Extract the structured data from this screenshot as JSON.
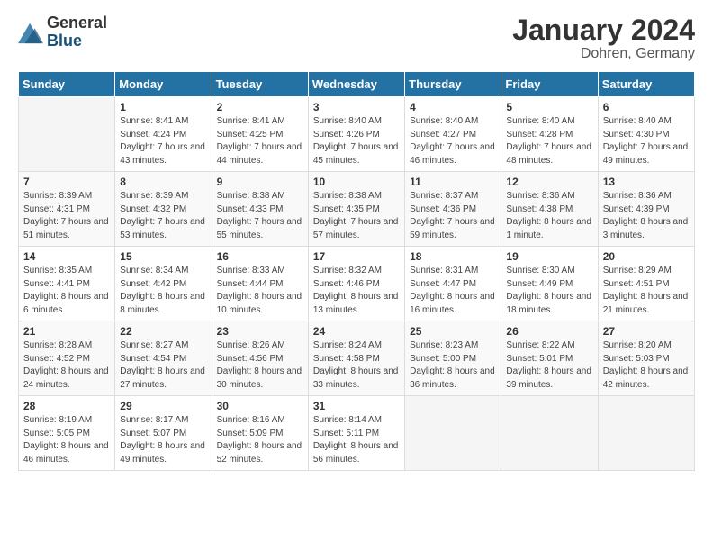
{
  "header": {
    "logo_general": "General",
    "logo_blue": "Blue",
    "title": "January 2024",
    "subtitle": "Dohren, Germany"
  },
  "days_of_week": [
    "Sunday",
    "Monday",
    "Tuesday",
    "Wednesday",
    "Thursday",
    "Friday",
    "Saturday"
  ],
  "weeks": [
    [
      {
        "day": "",
        "sunrise": "",
        "sunset": "",
        "daylight": ""
      },
      {
        "day": "1",
        "sunrise": "Sunrise: 8:41 AM",
        "sunset": "Sunset: 4:24 PM",
        "daylight": "Daylight: 7 hours and 43 minutes."
      },
      {
        "day": "2",
        "sunrise": "Sunrise: 8:41 AM",
        "sunset": "Sunset: 4:25 PM",
        "daylight": "Daylight: 7 hours and 44 minutes."
      },
      {
        "day": "3",
        "sunrise": "Sunrise: 8:40 AM",
        "sunset": "Sunset: 4:26 PM",
        "daylight": "Daylight: 7 hours and 45 minutes."
      },
      {
        "day": "4",
        "sunrise": "Sunrise: 8:40 AM",
        "sunset": "Sunset: 4:27 PM",
        "daylight": "Daylight: 7 hours and 46 minutes."
      },
      {
        "day": "5",
        "sunrise": "Sunrise: 8:40 AM",
        "sunset": "Sunset: 4:28 PM",
        "daylight": "Daylight: 7 hours and 48 minutes."
      },
      {
        "day": "6",
        "sunrise": "Sunrise: 8:40 AM",
        "sunset": "Sunset: 4:30 PM",
        "daylight": "Daylight: 7 hours and 49 minutes."
      }
    ],
    [
      {
        "day": "7",
        "sunrise": "Sunrise: 8:39 AM",
        "sunset": "Sunset: 4:31 PM",
        "daylight": "Daylight: 7 hours and 51 minutes."
      },
      {
        "day": "8",
        "sunrise": "Sunrise: 8:39 AM",
        "sunset": "Sunset: 4:32 PM",
        "daylight": "Daylight: 7 hours and 53 minutes."
      },
      {
        "day": "9",
        "sunrise": "Sunrise: 8:38 AM",
        "sunset": "Sunset: 4:33 PM",
        "daylight": "Daylight: 7 hours and 55 minutes."
      },
      {
        "day": "10",
        "sunrise": "Sunrise: 8:38 AM",
        "sunset": "Sunset: 4:35 PM",
        "daylight": "Daylight: 7 hours and 57 minutes."
      },
      {
        "day": "11",
        "sunrise": "Sunrise: 8:37 AM",
        "sunset": "Sunset: 4:36 PM",
        "daylight": "Daylight: 7 hours and 59 minutes."
      },
      {
        "day": "12",
        "sunrise": "Sunrise: 8:36 AM",
        "sunset": "Sunset: 4:38 PM",
        "daylight": "Daylight: 8 hours and 1 minute."
      },
      {
        "day": "13",
        "sunrise": "Sunrise: 8:36 AM",
        "sunset": "Sunset: 4:39 PM",
        "daylight": "Daylight: 8 hours and 3 minutes."
      }
    ],
    [
      {
        "day": "14",
        "sunrise": "Sunrise: 8:35 AM",
        "sunset": "Sunset: 4:41 PM",
        "daylight": "Daylight: 8 hours and 6 minutes."
      },
      {
        "day": "15",
        "sunrise": "Sunrise: 8:34 AM",
        "sunset": "Sunset: 4:42 PM",
        "daylight": "Daylight: 8 hours and 8 minutes."
      },
      {
        "day": "16",
        "sunrise": "Sunrise: 8:33 AM",
        "sunset": "Sunset: 4:44 PM",
        "daylight": "Daylight: 8 hours and 10 minutes."
      },
      {
        "day": "17",
        "sunrise": "Sunrise: 8:32 AM",
        "sunset": "Sunset: 4:46 PM",
        "daylight": "Daylight: 8 hours and 13 minutes."
      },
      {
        "day": "18",
        "sunrise": "Sunrise: 8:31 AM",
        "sunset": "Sunset: 4:47 PM",
        "daylight": "Daylight: 8 hours and 16 minutes."
      },
      {
        "day": "19",
        "sunrise": "Sunrise: 8:30 AM",
        "sunset": "Sunset: 4:49 PM",
        "daylight": "Daylight: 8 hours and 18 minutes."
      },
      {
        "day": "20",
        "sunrise": "Sunrise: 8:29 AM",
        "sunset": "Sunset: 4:51 PM",
        "daylight": "Daylight: 8 hours and 21 minutes."
      }
    ],
    [
      {
        "day": "21",
        "sunrise": "Sunrise: 8:28 AM",
        "sunset": "Sunset: 4:52 PM",
        "daylight": "Daylight: 8 hours and 24 minutes."
      },
      {
        "day": "22",
        "sunrise": "Sunrise: 8:27 AM",
        "sunset": "Sunset: 4:54 PM",
        "daylight": "Daylight: 8 hours and 27 minutes."
      },
      {
        "day": "23",
        "sunrise": "Sunrise: 8:26 AM",
        "sunset": "Sunset: 4:56 PM",
        "daylight": "Daylight: 8 hours and 30 minutes."
      },
      {
        "day": "24",
        "sunrise": "Sunrise: 8:24 AM",
        "sunset": "Sunset: 4:58 PM",
        "daylight": "Daylight: 8 hours and 33 minutes."
      },
      {
        "day": "25",
        "sunrise": "Sunrise: 8:23 AM",
        "sunset": "Sunset: 5:00 PM",
        "daylight": "Daylight: 8 hours and 36 minutes."
      },
      {
        "day": "26",
        "sunrise": "Sunrise: 8:22 AM",
        "sunset": "Sunset: 5:01 PM",
        "daylight": "Daylight: 8 hours and 39 minutes."
      },
      {
        "day": "27",
        "sunrise": "Sunrise: 8:20 AM",
        "sunset": "Sunset: 5:03 PM",
        "daylight": "Daylight: 8 hours and 42 minutes."
      }
    ],
    [
      {
        "day": "28",
        "sunrise": "Sunrise: 8:19 AM",
        "sunset": "Sunset: 5:05 PM",
        "daylight": "Daylight: 8 hours and 46 minutes."
      },
      {
        "day": "29",
        "sunrise": "Sunrise: 8:17 AM",
        "sunset": "Sunset: 5:07 PM",
        "daylight": "Daylight: 8 hours and 49 minutes."
      },
      {
        "day": "30",
        "sunrise": "Sunrise: 8:16 AM",
        "sunset": "Sunset: 5:09 PM",
        "daylight": "Daylight: 8 hours and 52 minutes."
      },
      {
        "day": "31",
        "sunrise": "Sunrise: 8:14 AM",
        "sunset": "Sunset: 5:11 PM",
        "daylight": "Daylight: 8 hours and 56 minutes."
      },
      {
        "day": "",
        "sunrise": "",
        "sunset": "",
        "daylight": ""
      },
      {
        "day": "",
        "sunrise": "",
        "sunset": "",
        "daylight": ""
      },
      {
        "day": "",
        "sunrise": "",
        "sunset": "",
        "daylight": ""
      }
    ]
  ]
}
